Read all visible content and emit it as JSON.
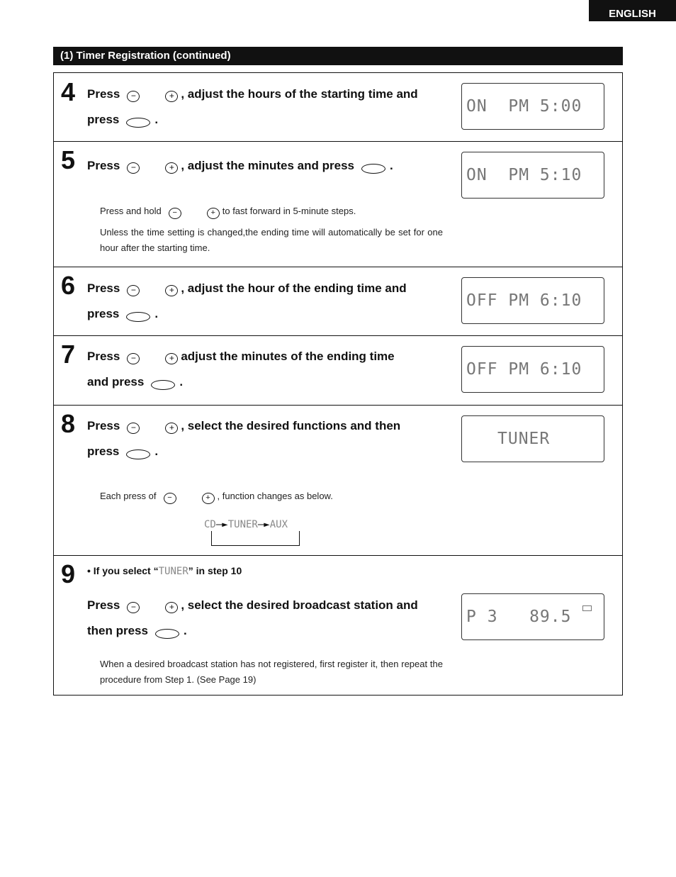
{
  "language_tab": "ENGLISH",
  "section_title": "(1) Timer Registration (continued)",
  "steps": [
    {
      "number": "4",
      "press": "Press",
      "text": ", adjust the hours of the starting time and",
      "line2": "press",
      "end": ".",
      "display": "ON  PM 5:00"
    },
    {
      "number": "5",
      "press": "Press",
      "text": ", adjust the minutes and press",
      "end": ".",
      "display": "ON  PM 5:10",
      "note1_pre": "Press and hold",
      "note1_post": "to fast forward in 5-minute steps.",
      "note2": "Unless the time setting is changed,the ending time will automatically be set for one hour after the starting time."
    },
    {
      "number": "6",
      "press": "Press",
      "text": ", adjust the hour of the ending time and",
      "line2": "press",
      "end": ".",
      "display": "OFF PM 6:10"
    },
    {
      "number": "7",
      "press": "Press",
      "text": "adjust the minutes of the ending time",
      "line2": "and press",
      "end": ".",
      "display": "OFF PM 6:10"
    },
    {
      "number": "8",
      "press": "Press",
      "text": ", select the desired functions and then",
      "line2": "press",
      "end": ".",
      "display": "TUNER",
      "note_pre": "Each press of",
      "note_post": ", function changes as below.",
      "flow": [
        "CD",
        "TUNER",
        "AUX"
      ]
    },
    {
      "number": "9",
      "bullet_pre": "If you select “",
      "bullet_seg": "TUNER",
      "bullet_post": "” in step 10",
      "press": "Press",
      "text": ", select the desired broadcast station and",
      "line2": "then press",
      "end": ".",
      "display": "P 3   89.5",
      "note": "When a desired broadcast station has not registered, first register it, then repeat the procedure from Step 1. (See Page 19)"
    }
  ]
}
